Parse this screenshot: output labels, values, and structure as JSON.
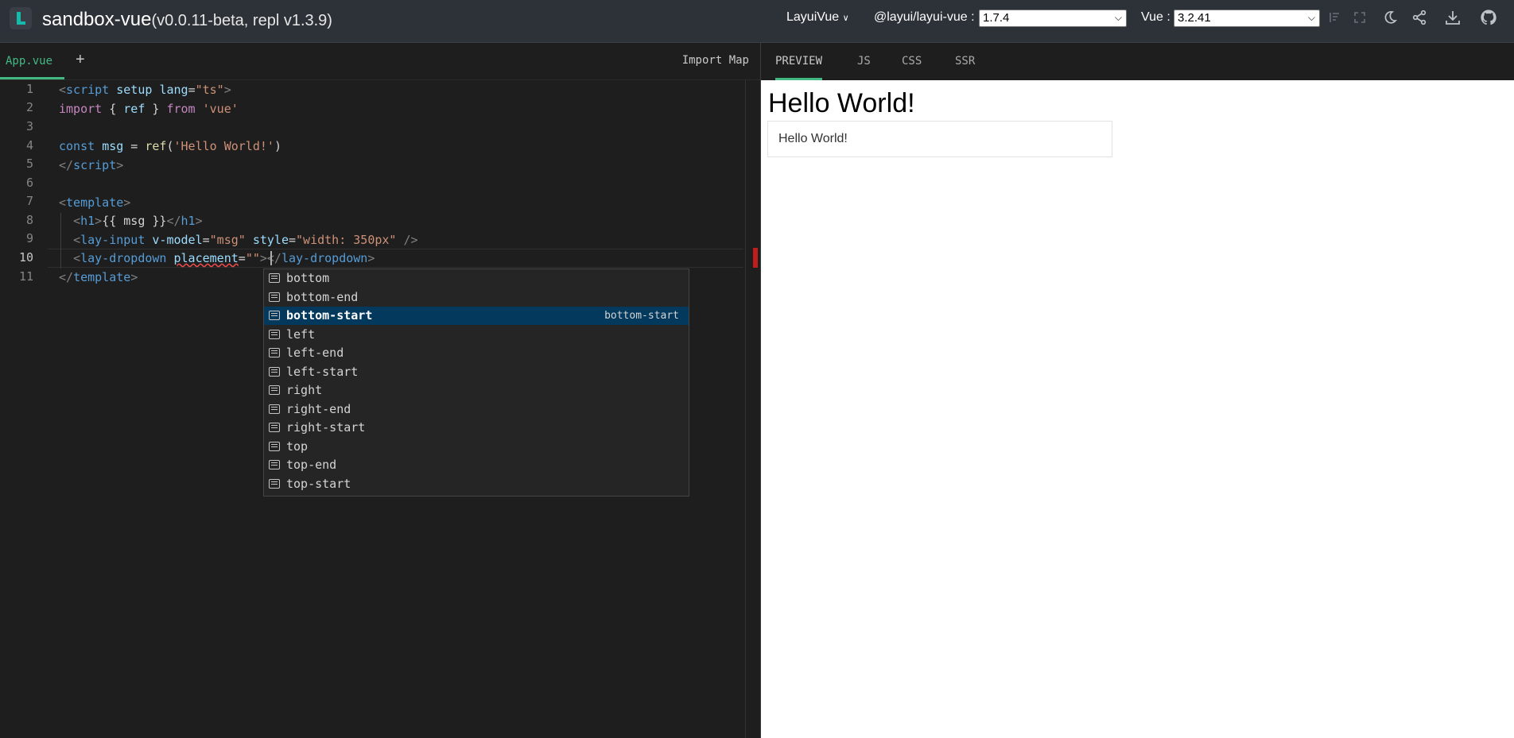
{
  "header": {
    "title": "sandbox-vue",
    "version": "(v0.0.11-beta, repl v1.3.9)",
    "library_menu": "LayuiVue",
    "layui_label": "@layui/layui-vue :",
    "layui_version": "1.7.4",
    "vue_label": "Vue :",
    "vue_version": "3.2.41",
    "icons": [
      "format-icon",
      "fullscreen-icon",
      "moon-icon",
      "share-icon",
      "download-icon",
      "github-icon"
    ]
  },
  "editor": {
    "file_tab": "App.vue",
    "add_tab": "+",
    "import_map": "Import Map",
    "line_numbers": [
      "1",
      "2",
      "3",
      "4",
      "5",
      "6",
      "7",
      "8",
      "9",
      "10",
      "11"
    ],
    "lines": [
      [
        "<",
        "script",
        " ",
        "setup",
        " ",
        "lang",
        "=",
        "\"ts\"",
        ">"
      ],
      [
        "import",
        " { ",
        "ref",
        " } ",
        "from",
        " ",
        "'vue'"
      ],
      [],
      [
        "const",
        " ",
        "msg",
        " = ",
        "ref",
        "(",
        "'Hello World!'",
        ")"
      ],
      [
        "</",
        "script",
        ">"
      ],
      [],
      [
        "<",
        "template",
        ">"
      ],
      [
        "  ",
        "<",
        "h1",
        ">",
        "{{ msg }}",
        "</",
        "h1",
        ">"
      ],
      [
        "  ",
        "<",
        "lay-input",
        " ",
        "v-model",
        "=",
        "\"msg\"",
        " ",
        "style",
        "=",
        "\"width: 350px\"",
        " />"
      ],
      [
        "  ",
        "<",
        "lay-dropdown",
        " ",
        "placement",
        "=",
        "\"\"",
        ">",
        "</",
        "lay-dropdown",
        ">"
      ],
      [
        "</",
        "template",
        ">"
      ]
    ]
  },
  "suggestions": {
    "items": [
      "bottom",
      "bottom-end",
      "bottom-start",
      "left",
      "left-end",
      "left-start",
      "right",
      "right-end",
      "right-start",
      "top",
      "top-end",
      "top-start"
    ],
    "selected": "bottom-start",
    "selected_detail": "bottom-start"
  },
  "preview": {
    "tabs": [
      "PREVIEW",
      "JS",
      "CSS",
      "SSR"
    ],
    "heading": "Hello World!",
    "input_value": "Hello World!"
  }
}
